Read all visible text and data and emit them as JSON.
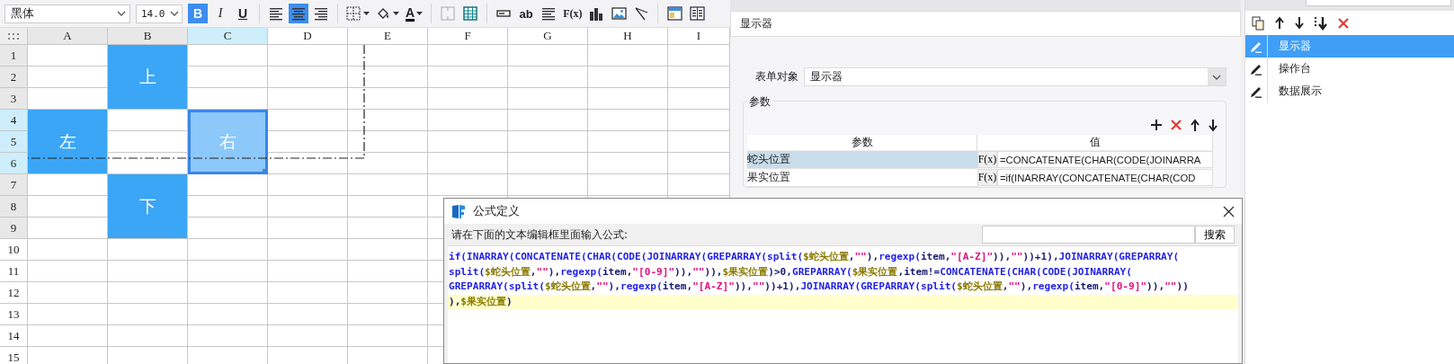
{
  "toolbar": {
    "font": "黑体",
    "font_size": "14.0",
    "buttons": [
      {
        "kind": "bold",
        "label": "B",
        "selected": true
      },
      {
        "kind": "italic",
        "label": "I",
        "selected": false
      },
      {
        "kind": "underline",
        "label": "U",
        "selected": false
      },
      {
        "kind": "separator"
      },
      {
        "kind": "align-left",
        "selected": false
      },
      {
        "kind": "align-center",
        "selected": true
      },
      {
        "kind": "align-right",
        "selected": false
      },
      {
        "kind": "separator"
      },
      {
        "kind": "borders",
        "selected": false
      },
      {
        "kind": "fill-color",
        "selected": false
      },
      {
        "kind": "font-color",
        "label": "A",
        "selected": false
      },
      {
        "kind": "separator"
      },
      {
        "kind": "merge-cells",
        "selected": false
      },
      {
        "kind": "table",
        "selected": false
      },
      {
        "kind": "separator"
      },
      {
        "kind": "text-field",
        "selected": false
      },
      {
        "kind": "text-label",
        "label": "ab",
        "selected": false
      },
      {
        "kind": "paragraph",
        "selected": false
      },
      {
        "kind": "formula",
        "label": "F(x)",
        "selected": false
      },
      {
        "kind": "bar-chart",
        "selected": false
      },
      {
        "kind": "image",
        "selected": false
      },
      {
        "kind": "slash",
        "selected": false
      },
      {
        "kind": "separator"
      },
      {
        "kind": "layout",
        "selected": false
      },
      {
        "kind": "columns",
        "selected": false
      }
    ]
  },
  "spreadsheet": {
    "columns": [
      {
        "label": "A",
        "shaded": true,
        "selected": false
      },
      {
        "label": "B",
        "shaded": true,
        "selected": false
      },
      {
        "label": "C",
        "shaded": false,
        "selected": true
      },
      {
        "label": "D",
        "shaded": false,
        "selected": false
      },
      {
        "label": "E",
        "shaded": false,
        "selected": false
      },
      {
        "label": "F",
        "shaded": false,
        "selected": false
      },
      {
        "label": "G",
        "shaded": false,
        "selected": false
      },
      {
        "label": "H",
        "shaded": false,
        "selected": false
      },
      {
        "label": "I",
        "shaded": false,
        "selected": false
      }
    ],
    "rows": [
      {
        "label": "1",
        "shaded": true,
        "selected": false
      },
      {
        "label": "2",
        "shaded": true,
        "selected": false
      },
      {
        "label": "3",
        "shaded": true,
        "selected": false
      },
      {
        "label": "4",
        "shaded": true,
        "selected": true
      },
      {
        "label": "5",
        "shaded": true,
        "selected": true
      },
      {
        "label": "6",
        "shaded": true,
        "selected": true
      },
      {
        "label": "7",
        "shaded": true,
        "selected": false
      },
      {
        "label": "8",
        "shaded": true,
        "selected": false
      },
      {
        "label": "9",
        "shaded": true,
        "selected": false
      },
      {
        "label": "10",
        "shaded": false,
        "selected": false
      },
      {
        "label": "11",
        "shaded": false,
        "selected": false
      },
      {
        "label": "12",
        "shaded": false,
        "selected": false
      },
      {
        "label": "13",
        "shaded": false,
        "selected": false
      },
      {
        "label": "14",
        "shaded": false,
        "selected": false
      },
      {
        "label": "15",
        "shaded": false,
        "selected": false
      }
    ],
    "merged_cells": [
      {
        "text": "上",
        "selected": false
      },
      {
        "text": "左",
        "selected": false
      },
      {
        "text": "右",
        "selected": true
      },
      {
        "text": "下",
        "selected": false
      }
    ]
  },
  "properties_panel": {
    "title": "显示器",
    "form_object_label": "表单对象",
    "form_object": "显示器",
    "params_group": "参数",
    "param_headers": [
      "参数",
      "值"
    ],
    "params": [
      {
        "name": "蛇头位置",
        "formula_button": "F(x)",
        "value": "=CONCATENATE(CHAR(CODE(JOINARRA",
        "selected": true
      },
      {
        "name": "果实位置",
        "formula_button": "F(x)",
        "value": "=if(INARRAY(CONCATENATE(CHAR(COD",
        "selected": false
      }
    ]
  },
  "widget_list": {
    "items": [
      {
        "label": "显示器",
        "selected": true
      },
      {
        "label": "操作台",
        "selected": false
      },
      {
        "label": "数据展示",
        "selected": false
      }
    ]
  },
  "dialog": {
    "title": "公式定义",
    "prompt": "请在下面的文本编辑框里面输入公式:",
    "search_button": "搜索",
    "formula_lines": [
      {
        "current": false,
        "tokens": [
          {
            "kind": "fn",
            "text": "if(INARRAY(CONCATENATE(CHAR(CODE(JOINARRAY(GREPARRAY(split("
          },
          {
            "kind": "var",
            "text": "$蛇头位置"
          },
          {
            "kind": "plain",
            "text": ","
          },
          {
            "kind": "str",
            "text": "\"\""
          },
          {
            "kind": "plain",
            "text": "),"
          },
          {
            "kind": "fn",
            "text": "regexp("
          },
          {
            "kind": "plain",
            "text": "item,"
          },
          {
            "kind": "str",
            "text": "\"[A-Z]\""
          },
          {
            "kind": "plain",
            "text": ")),"
          },
          {
            "kind": "str",
            "text": "\"\""
          },
          {
            "kind": "plain",
            "text": "))+1),"
          },
          {
            "kind": "fn",
            "text": "JOINARRAY(GREPARRAY("
          }
        ]
      },
      {
        "current": false,
        "tokens": [
          {
            "kind": "fn",
            "text": "split("
          },
          {
            "kind": "var",
            "text": "$蛇头位置"
          },
          {
            "kind": "plain",
            "text": ","
          },
          {
            "kind": "str",
            "text": "\"\""
          },
          {
            "kind": "plain",
            "text": "),"
          },
          {
            "kind": "fn",
            "text": "regexp("
          },
          {
            "kind": "plain",
            "text": "item,"
          },
          {
            "kind": "str",
            "text": "\"[0-9]\""
          },
          {
            "kind": "plain",
            "text": ")),"
          },
          {
            "kind": "str",
            "text": "\"\""
          },
          {
            "kind": "plain",
            "text": ")),"
          },
          {
            "kind": "var",
            "text": "$果实位置"
          },
          {
            "kind": "plain",
            "text": ")>0,"
          },
          {
            "kind": "fn",
            "text": "GREPARRAY("
          },
          {
            "kind": "var",
            "text": "$果实位置"
          },
          {
            "kind": "plain",
            "text": ",item!="
          },
          {
            "kind": "fn",
            "text": "CONCATENATE(CHAR(CODE(JOINARRAY("
          }
        ]
      },
      {
        "current": false,
        "tokens": [
          {
            "kind": "fn",
            "text": "GREPARRAY(split("
          },
          {
            "kind": "var",
            "text": "$蛇头位置"
          },
          {
            "kind": "plain",
            "text": ","
          },
          {
            "kind": "str",
            "text": "\"\""
          },
          {
            "kind": "plain",
            "text": "),"
          },
          {
            "kind": "fn",
            "text": "regexp("
          },
          {
            "kind": "plain",
            "text": "item,"
          },
          {
            "kind": "str",
            "text": "\"[A-Z]\""
          },
          {
            "kind": "plain",
            "text": ")),"
          },
          {
            "kind": "str",
            "text": "\"\""
          },
          {
            "kind": "plain",
            "text": "))+1),"
          },
          {
            "kind": "fn",
            "text": "JOINARRAY(GREPARRAY(split("
          },
          {
            "kind": "var",
            "text": "$蛇头位置"
          },
          {
            "kind": "plain",
            "text": ","
          },
          {
            "kind": "str",
            "text": "\"\""
          },
          {
            "kind": "plain",
            "text": "),"
          },
          {
            "kind": "fn",
            "text": "regexp("
          },
          {
            "kind": "plain",
            "text": "item,"
          },
          {
            "kind": "str",
            "text": "\"[0-9]\""
          },
          {
            "kind": "plain",
            "text": ")),"
          },
          {
            "kind": "str",
            "text": "\"\""
          },
          {
            "kind": "plain",
            "text": "))"
          }
        ]
      },
      {
        "current": true,
        "tokens": [
          {
            "kind": "plain",
            "text": "),"
          },
          {
            "kind": "var",
            "text": "$果实位置"
          },
          {
            "kind": "plain",
            "text": ")"
          }
        ]
      }
    ]
  }
}
